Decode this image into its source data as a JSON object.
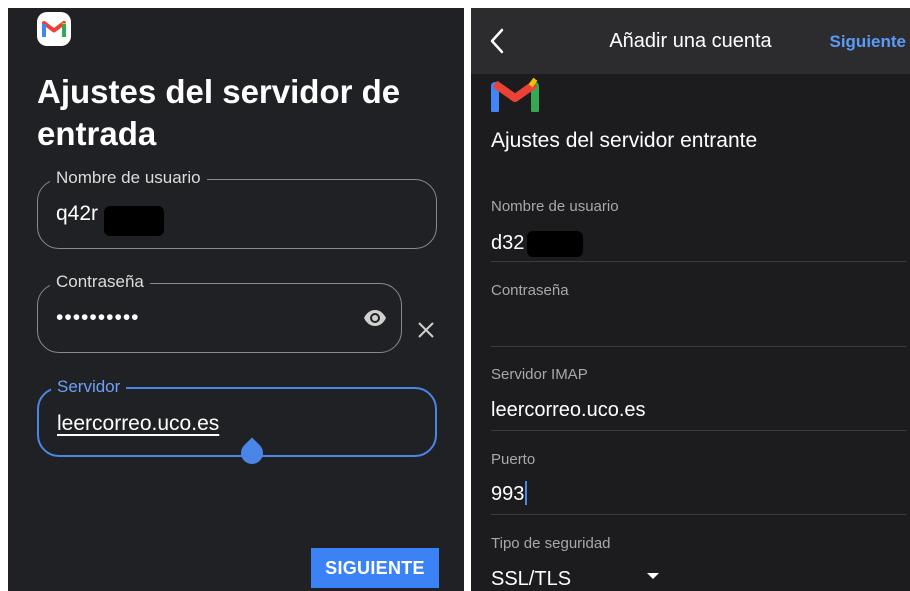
{
  "left": {
    "logo": "gmail-logo",
    "title": "Ajustes del servidor de entrada",
    "username": {
      "label": "Nombre de usuario",
      "value": "q42r"
    },
    "password": {
      "label": "Contraseña",
      "value": "••••••••••"
    },
    "server": {
      "label": "Servidor",
      "value": "leercorreo.uco.es"
    },
    "next_label": "SIGUIENTE"
  },
  "right": {
    "header": {
      "title": "Añadir una cuenta",
      "next_label": "Siguiente"
    },
    "logo": "gmail-logo",
    "heading": "Ajustes del servidor entrante",
    "username": {
      "label": "Nombre de usuario",
      "value": "d32"
    },
    "password": {
      "label": "Contraseña",
      "value": ""
    },
    "imap": {
      "label": "Servidor IMAP",
      "value": "leercorreo.uco.es"
    },
    "port": {
      "label": "Puerto",
      "value": "993"
    },
    "security": {
      "label": "Tipo de seguridad",
      "value": "SSL/TLS"
    }
  },
  "colors": {
    "accent": "#4a86e8",
    "button": "#3b82f6",
    "link": "#5b9bf7"
  }
}
